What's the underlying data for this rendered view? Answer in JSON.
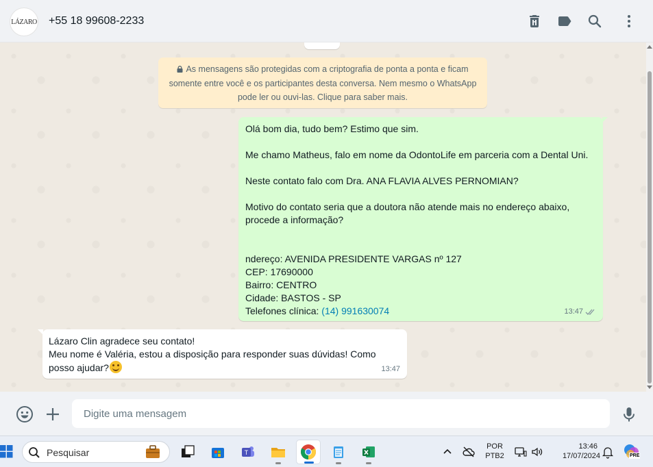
{
  "header": {
    "avatar_text": "LÁZARO",
    "contact_name": "+55 18 99608-2233",
    "icons": [
      "delete-icon",
      "label-icon",
      "search-icon",
      "menu-icon"
    ]
  },
  "encryption_notice": {
    "line1": "As mensagens são protegidas com a criptografia de ponta a ponta e ficam",
    "line2": "somente entre você e os participantes desta conversa. Nem mesmo o WhatsApp",
    "line3": "pode ler ou ouvi-las. Clique para saber mais."
  },
  "messages": {
    "outgoing": {
      "lines": [
        "Olá bom dia, tudo bem? Estimo que sim.",
        "",
        "Me chamo Matheus, falo em nome da OdontoLife em parceria com a Dental Uni.",
        "",
        "Neste contato falo com Dra. ANA FLAVIA ALVES PERNOMIAN?",
        "",
        "Motivo do contato seria que a doutora não atende mais no endereço abaixo,",
        "procede a informação?",
        "",
        "",
        "ndereço: AVENIDA PRESIDENTE VARGAS nº 127",
        "CEP: 17690000",
        "Bairro: CENTRO",
        "Cidade: BASTOS - SP"
      ],
      "phone_label": "Telefones clínica: ",
      "phone_link": "(14) 991630074",
      "time": "13:47",
      "status": "delivered"
    },
    "incoming": {
      "line1": "Lázaro Clin agradece seu contato!",
      "line2": "Meu nome é Valéria, estou a disposição para responder suas dúvidas! Como",
      "line3": "posso ajudar?",
      "time": "13:47"
    }
  },
  "composer": {
    "placeholder": "Digite uma mensagem"
  },
  "taskbar": {
    "search_label": "Pesquisar",
    "lang_top": "POR",
    "lang_bottom": "PTB2",
    "time": "13:46",
    "date": "17/07/2024",
    "copilot_badge": "PRE"
  },
  "colors": {
    "outgoing_bubble": "#d9fdd3",
    "incoming_bubble": "#ffffff",
    "notice_bg": "#ffeecd",
    "link": "#027eb5",
    "chat_bg": "#efeae2"
  }
}
